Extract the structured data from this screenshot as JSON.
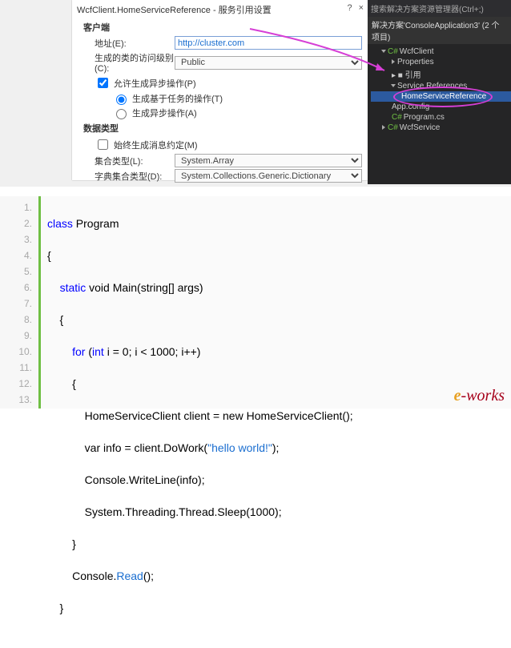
{
  "dialog": {
    "title": "WcfClient.HomeServiceReference - 服务引用设置",
    "help": "?",
    "close": "×",
    "section_client": "客户端",
    "label_address": "地址(E):",
    "address": "http://cluster.com",
    "label_access": "生成的类的访问级别(C):",
    "access": "Public",
    "allow_async": "允许生成异步操作(P)",
    "radio_task": "生成基于任务的操作(T)",
    "radio_async": "生成异步操作(A)",
    "section_data": "数据类型",
    "reuse_always": "始终生成消息约定(M)",
    "label_coll": "集合类型(L):",
    "coll": "System.Array",
    "label_dict": "字典集合类型(D):",
    "dict": "System.Collections.Generic.Dictionary"
  },
  "explorer": {
    "search": "搜索解决方案资源管理器(Ctrl+;)",
    "solution": "解决方案'ConsoleApplication3' (2 个项目)",
    "project": "WcfClient",
    "properties": "Properties",
    "refs": "▸ ■ 引用",
    "svc": "Service References",
    "svcref": "HomeServiceReference",
    "appcfg": "App.config",
    "program": "Program.cs",
    "svcproj": "WcfService"
  },
  "code": {
    "l1_a": "class",
    "l1_b": " Program",
    "l2": "{",
    "l3_a": "    ",
    "l3_b": "static",
    "l3_c": " void Main(string[] args)",
    "l4": "    {",
    "l5_a": "        ",
    "l5_b": "for",
    "l5_c": " (",
    "l5_d": "int",
    "l5_e": " i = 0; i < 1000; i++)",
    "l6": "        {",
    "l7": "            HomeServiceClient client = new HomeServiceClient();",
    "l8_a": "            var info = client.DoWork(",
    "l8_b": "\"hello world!\"",
    "l8_c": ");",
    "l9": "            Console.WriteLine(info);",
    "l10": "            System.Threading.Thread.Sleep(1000);",
    "l11": "        }",
    "l12_a": "        Console.",
    "l12_b": "Read",
    "l12_c": "();",
    "l13": "    }"
  },
  "lines": [
    "1.",
    "2.",
    "3.",
    "4.",
    "5.",
    "6.",
    "7.",
    "8.",
    "9.",
    "10.",
    "11.",
    "12.",
    "13."
  ],
  "watermark": {
    "e": "e",
    "w": "-works"
  }
}
